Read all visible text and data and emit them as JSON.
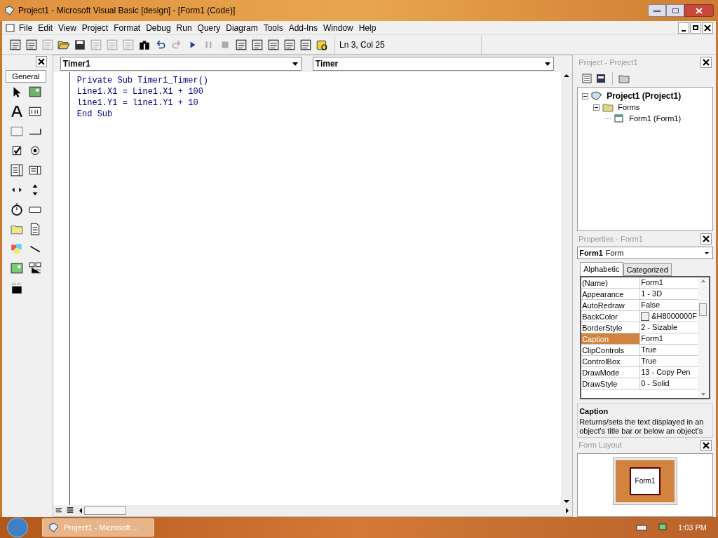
{
  "window": {
    "title": "Project1 - Microsoft Visual Basic [design] - [Form1 (Code)]"
  },
  "menu": [
    "File",
    "Edit",
    "View",
    "Project",
    "Format",
    "Debug",
    "Run",
    "Query",
    "Diagram",
    "Tools",
    "Add-Ins",
    "Window",
    "Help"
  ],
  "toolbar": {
    "position": "Ln 3, Col 25"
  },
  "toolbox": {
    "tab": "General"
  },
  "code": {
    "object": "Timer1",
    "procedure": "Timer",
    "lines": [
      "Private Sub Timer1_Timer()",
      "Line1.X1 = Line1.X1 + 100",
      "line1.Y1 = line1.Y1 + 10",
      "End Sub"
    ]
  },
  "project": {
    "title": "Project - Project1",
    "tree": [
      {
        "label": "Project1 (Project1)",
        "expanded": true,
        "children": [
          {
            "label": "Forms",
            "expanded": true,
            "children": [
              {
                "label": "Form1 (Form1)"
              }
            ]
          }
        ]
      }
    ]
  },
  "properties": {
    "title": "Properties - Form1",
    "object": "Form1",
    "object_type": "Form",
    "tabs": [
      {
        "label": "Alphabetic",
        "selected": true
      },
      {
        "label": "Categorized",
        "selected": false
      }
    ],
    "rows": [
      {
        "name": "(Name)",
        "value": "Form1",
        "selected": false
      },
      {
        "name": "Appearance",
        "value": "1 - 3D",
        "selected": false
      },
      {
        "name": "AutoRedraw",
        "value": "False",
        "selected": false
      },
      {
        "name": "BackColor",
        "value": "&H8000000F",
        "selected": false,
        "kind": "color"
      },
      {
        "name": "BorderStyle",
        "value": "2 - Sizable",
        "selected": false
      },
      {
        "name": "Caption",
        "value": "Form1",
        "selected": true
      },
      {
        "name": "ClipControls",
        "value": "True",
        "selected": false
      },
      {
        "name": "ControlBox",
        "value": "True",
        "selected": false
      },
      {
        "name": "DrawMode",
        "value": "13 - Copy Pen",
        "selected": false
      },
      {
        "name": "DrawStyle",
        "value": "0 - Solid",
        "selected": false
      }
    ],
    "description": {
      "title": "Caption",
      "text": "Returns/sets the text displayed in an object's title bar or below an object's"
    }
  },
  "form_layout": {
    "title": "Form Layout",
    "form": "Form1"
  },
  "taskbar": {
    "button": "Project1 - Microsoft ...",
    "clock": "1:03 PM"
  }
}
